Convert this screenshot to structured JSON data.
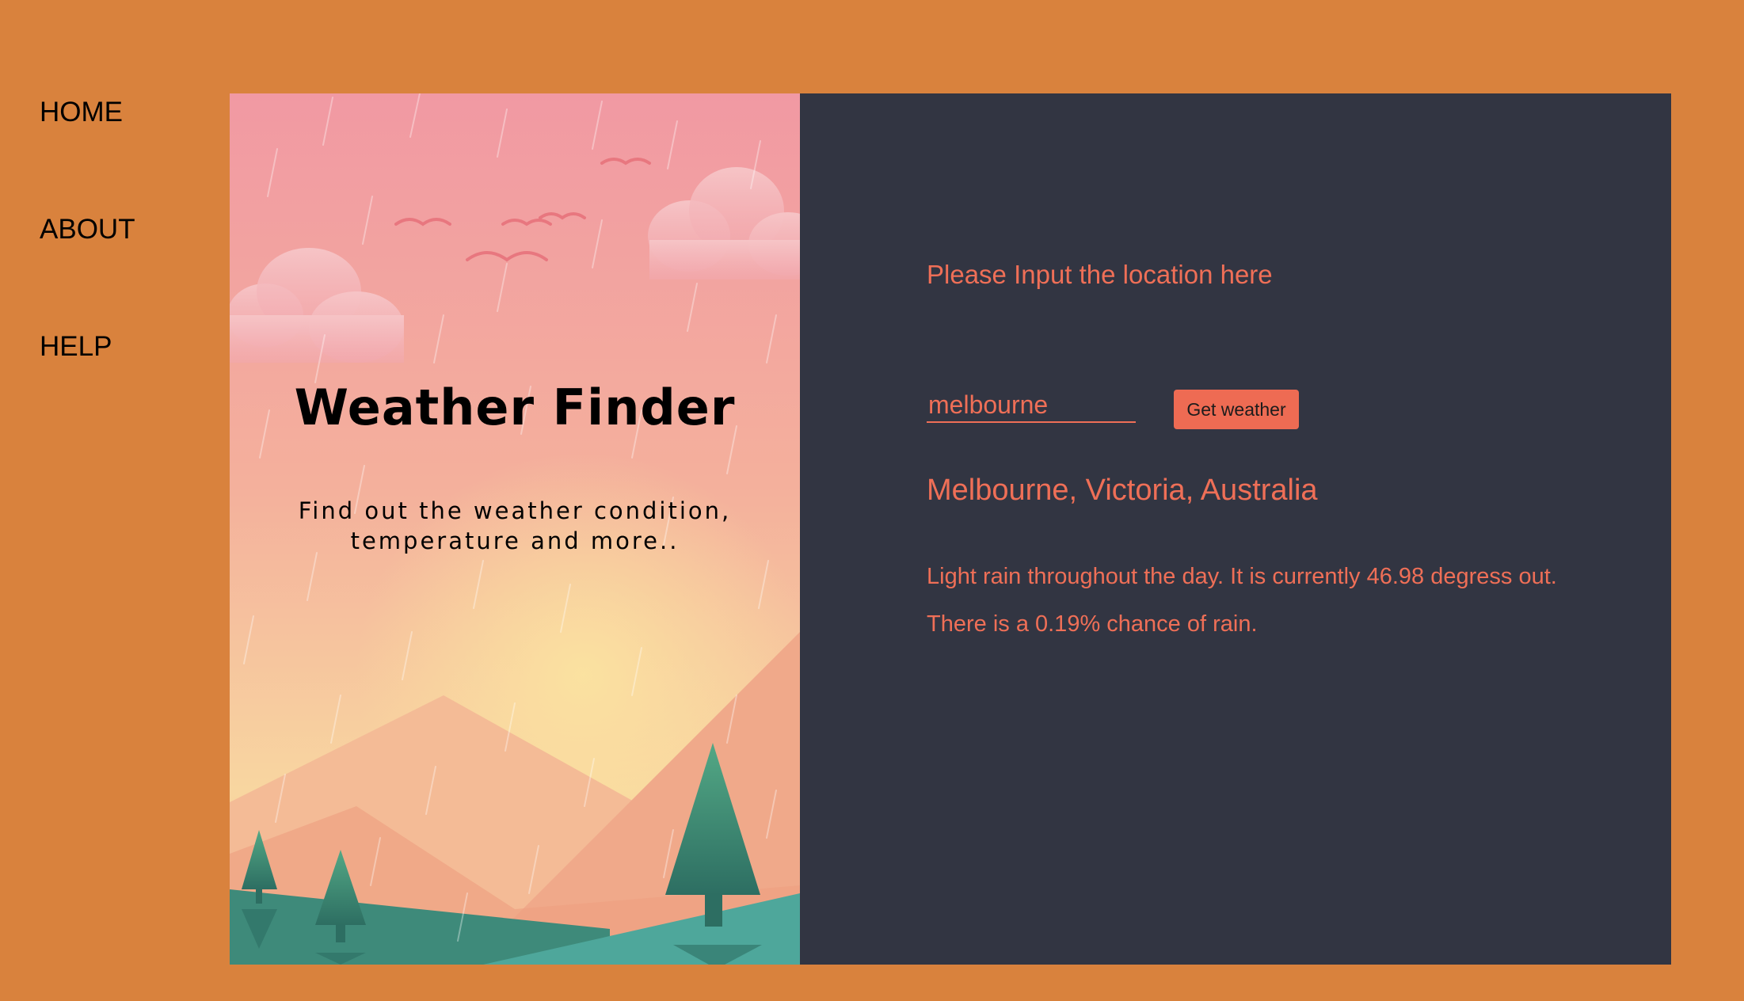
{
  "colors": {
    "page_background": "#d9823d",
    "panel_background": "#323542",
    "accent": "#ef6f57"
  },
  "nav": {
    "items": [
      {
        "label": "HOME"
      },
      {
        "label": "ABOUT"
      },
      {
        "label": "HELP"
      }
    ]
  },
  "hero": {
    "title": "Weather Finder",
    "subtitle_line1": "Find out the weather condition,",
    "subtitle_line2": "temperature and more.."
  },
  "form": {
    "prompt": "Please Input the location here",
    "location_value": "melbourne",
    "submit_label": "Get weather"
  },
  "result": {
    "location": "Melbourne, Victoria, Australia",
    "description": "Light rain throughout the day. It is currently 46.98 degress out.",
    "rain_chance": "There is a 0.19% chance of rain."
  }
}
